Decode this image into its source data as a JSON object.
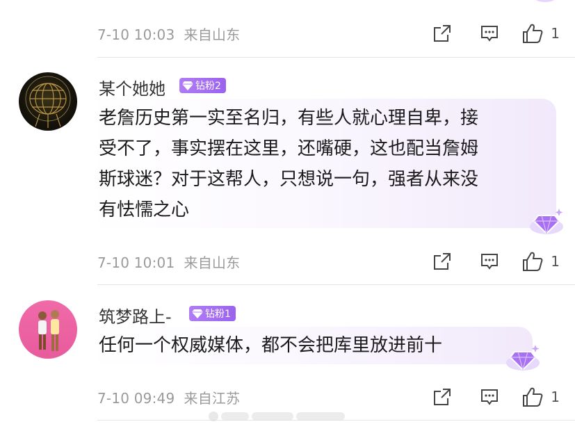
{
  "comments": [
    {
      "time": "7-10 10:03",
      "location": "来自山东",
      "likes": "1"
    },
    {
      "username": "某个她她",
      "badge": "钻粉2",
      "text_lines": [
        "老詹历史第一实至名归，有些人就心理自卑，接",
        "受不了，事实摆在这里，还嘴硬，这也配当詹姆",
        "斯球迷？对于这帮人，只想说一句，强者从来没",
        "有怯懦之心"
      ],
      "time": "7-10 10:01",
      "location": "来自山东",
      "likes": "1"
    },
    {
      "username": "筑梦路上-",
      "badge": "钻粉1",
      "text_lines": [
        "任何一个权威媒体，都不会把库里放进前十"
      ],
      "time": "7-10 09:49",
      "location": "来自江苏",
      "likes": "1"
    }
  ],
  "icons": {
    "share": "share-icon",
    "comment": "comment-icon",
    "like": "thumbs-up-icon",
    "badge": "diamond-icon",
    "decoration": "diamond-gem-icon"
  },
  "colors": {
    "badge_purple": "#9b63ee",
    "meta_gray": "#9a9a9a",
    "bubble_tint": "#f1e9fb"
  }
}
